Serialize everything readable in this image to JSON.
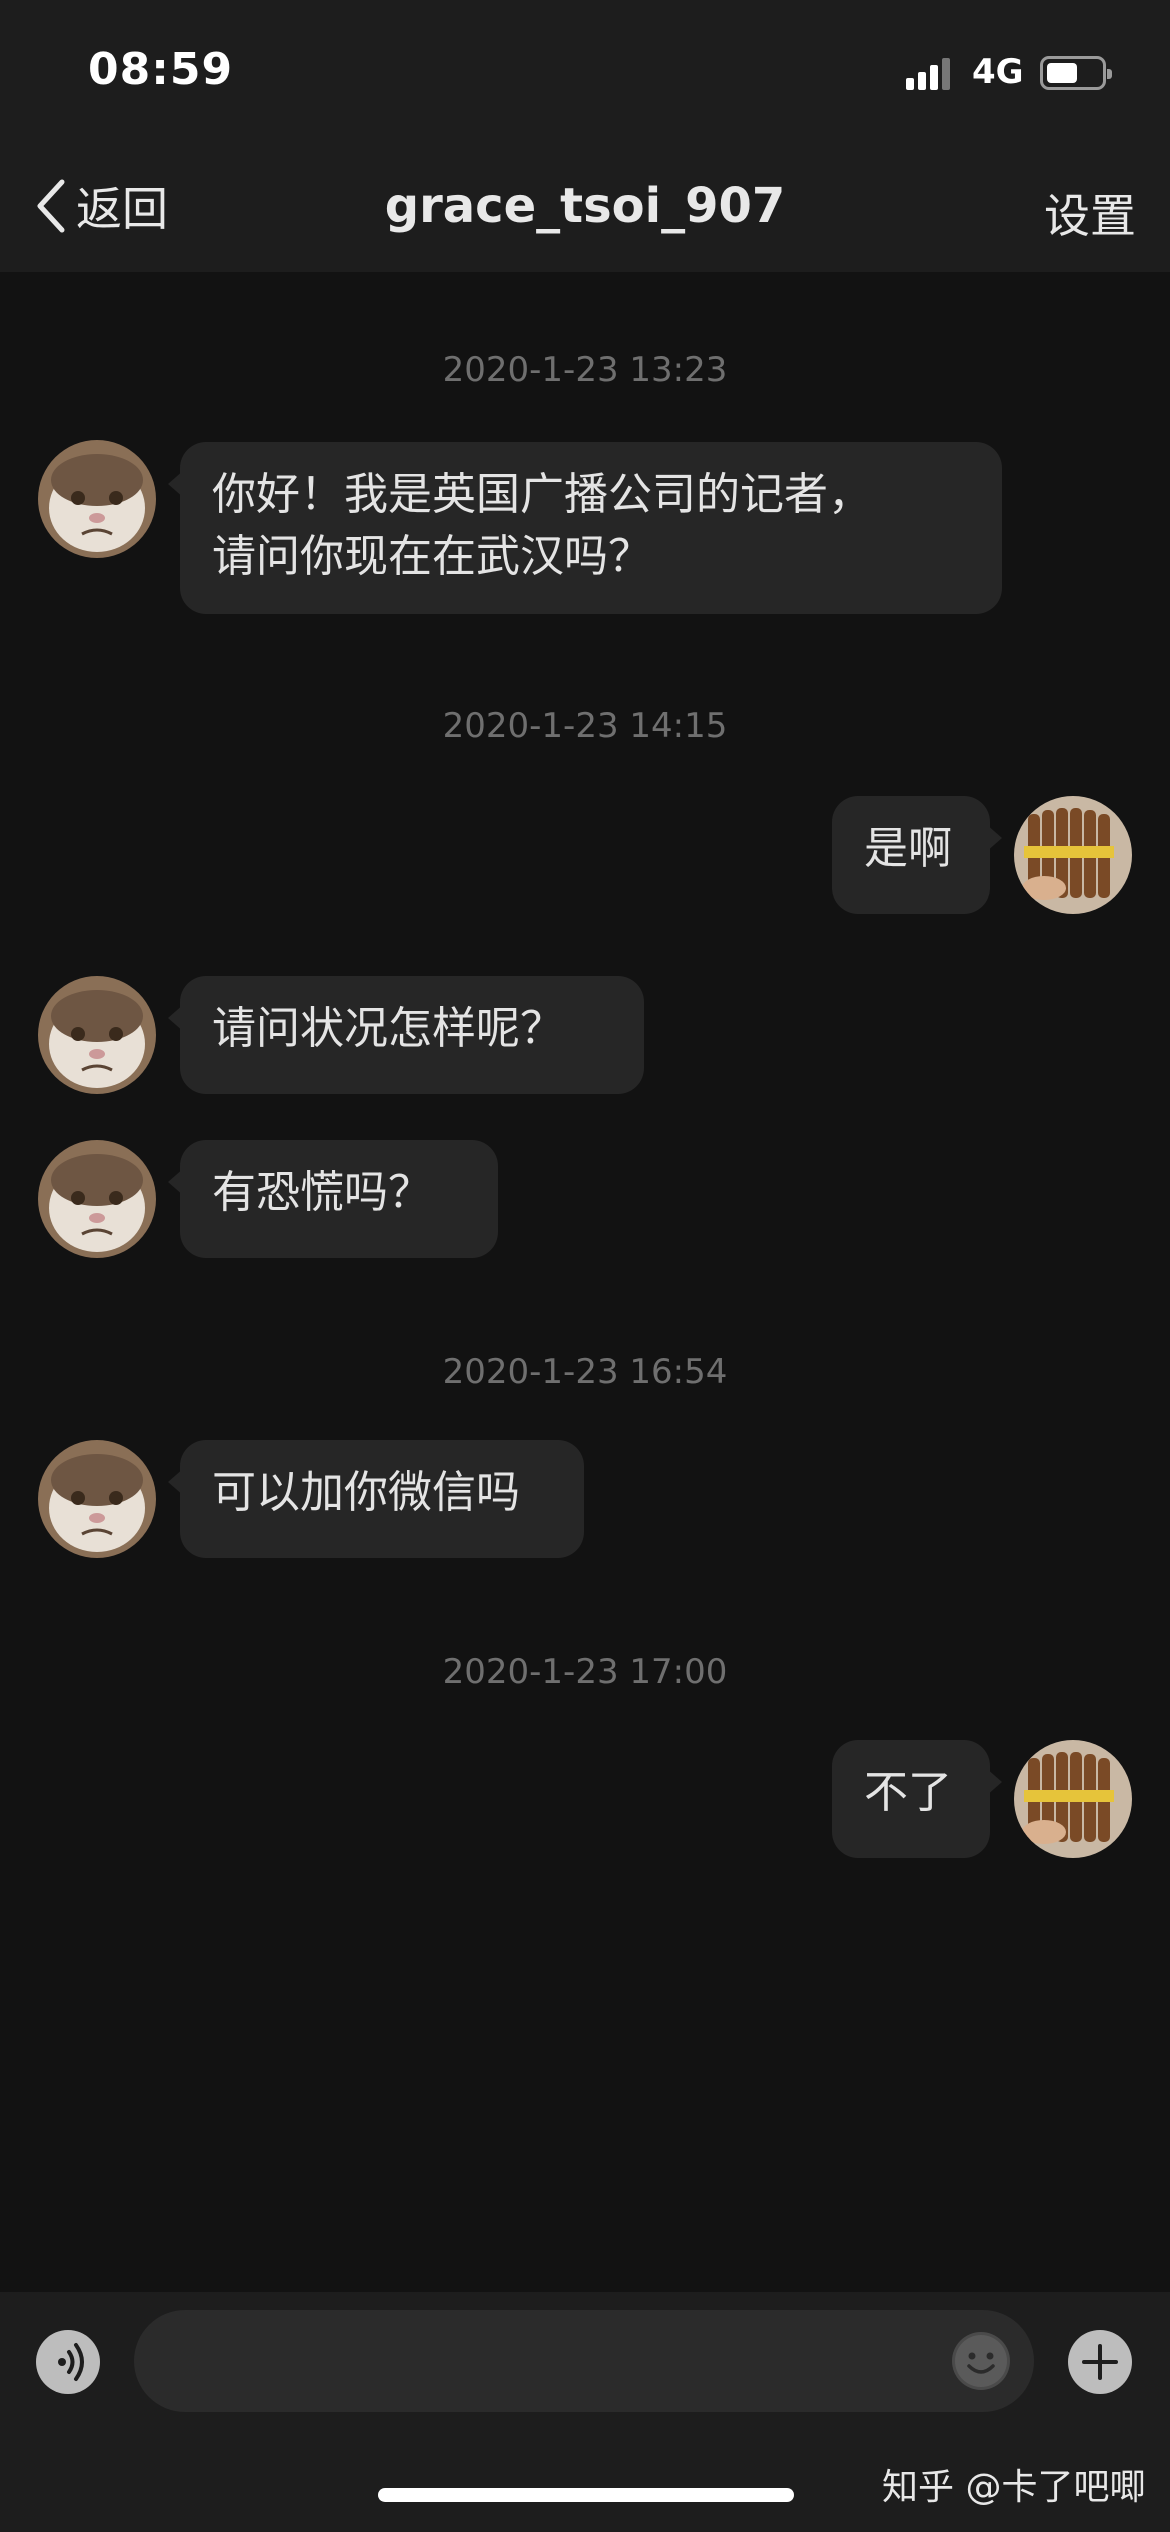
{
  "status_bar": {
    "time": "08:59",
    "network": "4G",
    "battery_level": 0.55
  },
  "nav": {
    "back_label": "返回",
    "title": "grace_tsoi_907",
    "settings_label": "设置"
  },
  "messages": {
    "ts1": "2020-1-23 13:23",
    "m1": "你好！我是英国广播公司的记者，",
    "m1b": "请问你现在在武汉吗？",
    "ts2": "2020-1-23 14:15",
    "m2": "是啊",
    "m3": "请问状况怎样呢？",
    "m4": "有恐慌吗？",
    "ts3": "2020-1-23 16:54",
    "m5": "可以加你微信吗",
    "ts4": "2020-1-23 17:00",
    "m6": "不了"
  },
  "input": {
    "placeholder": ""
  },
  "watermark": "知乎 @卡了吧唧",
  "colors": {
    "background": "#121212",
    "bar": "#1d1d1d",
    "bubble": "#262626",
    "timestamp": "#6f6f6f"
  }
}
